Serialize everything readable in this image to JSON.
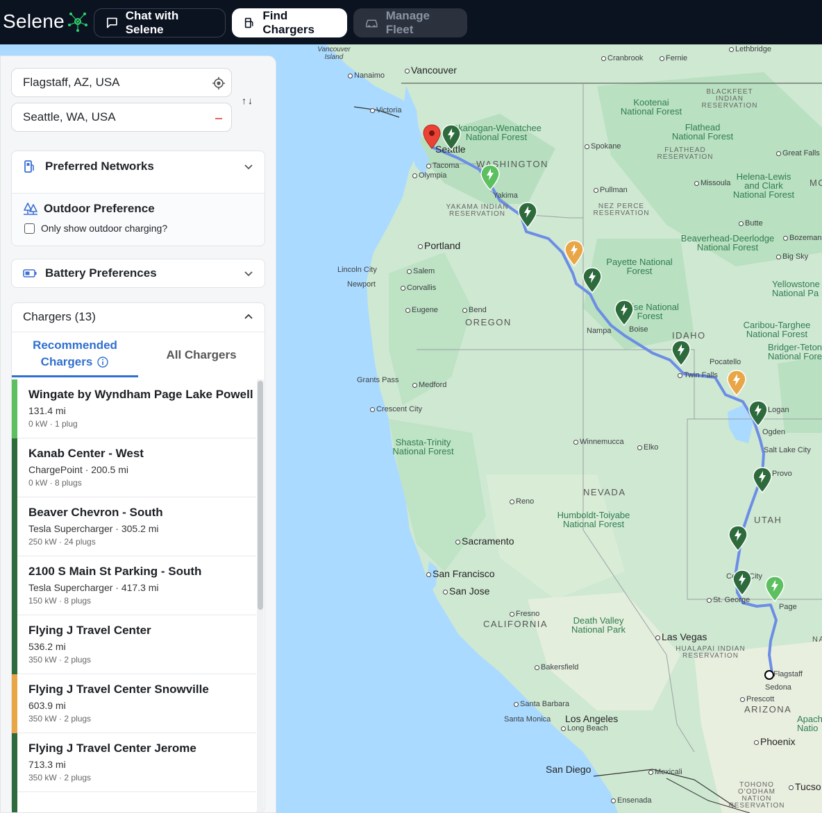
{
  "header": {
    "logo_text": "Selene",
    "nav": {
      "chat_label": "Chat with Selene",
      "find_label": "Find Chargers",
      "fleet_label": "Manage Fleet"
    }
  },
  "route": {
    "from_value": "Flagstaff, AZ, USA",
    "to_value": "Seattle, WA, USA",
    "swap_label": "↑↓"
  },
  "preferred_networks": {
    "title": "Preferred Networks"
  },
  "outdoor": {
    "title": "Outdoor Preference",
    "checkbox_label": "Only show outdoor charging?",
    "checked": false
  },
  "battery": {
    "title": "Battery Preferences"
  },
  "chargers": {
    "title": "Chargers (13)",
    "tabs": {
      "recommended_line1": "Recommended",
      "recommended_line2": "Chargers",
      "all": "All Chargers"
    },
    "items": [
      {
        "name": "Wingate by Wyndham Page Lake Powell",
        "sub": "131.4 mi",
        "meta": "0 kW · 1 plug",
        "color": "#5cbf60"
      },
      {
        "name": "Kanab Center - West",
        "sub": "ChargePoint · 200.5 mi",
        "meta": "0 kW · 8 plugs",
        "color": "#2e6b3c"
      },
      {
        "name": "Beaver Chevron - South",
        "sub": "Tesla Supercharger · 305.2 mi",
        "meta": "250 kW · 24 plugs",
        "color": "#2e6b3c"
      },
      {
        "name": "2100 S Main St Parking - South",
        "sub": "Tesla Supercharger · 417.3 mi",
        "meta": "150 kW · 8 plugs",
        "color": "#2e6b3c"
      },
      {
        "name": "Flying J Travel Center",
        "sub": "536.2 mi",
        "meta": "350 kW · 2 plugs",
        "color": "#2e6b3c"
      },
      {
        "name": "Flying J Travel Center Snowville",
        "sub": "603.9 mi",
        "meta": "350 kW · 2 plugs",
        "color": "#e9a646"
      },
      {
        "name": "Flying J Travel Center Jerome",
        "sub": "713.3 mi",
        "meta": "350 kW · 2 plugs",
        "color": "#2e6b3c"
      },
      {
        "name": "",
        "sub": "",
        "meta": "",
        "color": "#2e6b3c"
      }
    ]
  },
  "map": {
    "labels": {
      "vancouver_island": "Vancouver Island",
      "nanaimo": "Nanaimo",
      "vancouver": "Vancouver",
      "victoria": "Victoria",
      "seattle": "Seattle",
      "tacoma": "Tacoma",
      "olympia": "Olympia",
      "washington": "WASHINGTON",
      "okanogan": "Okanogan-Wenatchee National Forest",
      "yakima": "Yakima",
      "yakama": "YAKAMA INDIAN RESERVATION",
      "portland": "Portland",
      "lincoln_city": "Lincoln City",
      "salem": "Salem",
      "newport": "Newport",
      "corvallis": "Corvallis",
      "eugene": "Eugene",
      "bend": "Bend",
      "oregon": "OREGON",
      "grants_pass": "Grants Pass",
      "medford": "Medford",
      "crescent_city": "Crescent City",
      "shasta": "Shasta-Trinity National Forest",
      "cranbrook": "Cranbrook",
      "fernie": "Fernie",
      "lethbridge": "Lethbridge",
      "kootenai": "Kootenai National Forest",
      "blackfeet": "BLACKFEET INDIAN RESERVATION",
      "flathead_nf": "Flathead National Forest",
      "flathead_res": "FLATHEAD RESERVATION",
      "spokane": "Spokane",
      "great_falls": "Great Falls",
      "helena": "Helena-Lewis and Clark National Forest",
      "missoula": "Missoula",
      "mo": "MO",
      "pullman": "Pullman",
      "nez_perce": "NEZ PERCE RESERVATION",
      "butte": "Butte",
      "beaverhead": "Beaverhead-Deerlodge National Forest",
      "bozeman": "Bozeman",
      "big_sky": "Big Sky",
      "payette": "Payette National Forest",
      "yellowstone": "Yellowstone National Pa",
      "boise_nf": "Boise National Forest",
      "boise": "Boise",
      "nampa": "Nampa",
      "idaho": "IDAHO",
      "caribou": "Caribou-Targhee National Forest",
      "bridger": "Bridger-Teton National Fore",
      "pocatello": "Pocatello",
      "twin_falls": "Twin Falls",
      "logan": "Logan",
      "ogden": "Ogden",
      "salt_lake": "Salt Lake City",
      "provo": "Provo",
      "winnemucca": "Winnemucca",
      "elko": "Elko",
      "nevada": "NEVADA",
      "reno": "Reno",
      "humboldt": "Humboldt-Toiyabe National Forest",
      "utah": "UTAH",
      "sacramento": "Sacramento",
      "san_francisco": "San Francisco",
      "san_jose": "San Jose",
      "cedar_city": "Cedar City",
      "st_george": "St. George",
      "page": "Page",
      "fresno": "Fresno",
      "california": "CALIFORNIA",
      "death_valley": "Death Valley National Park",
      "las_vegas": "Las Vegas",
      "hualapai": "HUALAPAI INDIAN RESERVATION",
      "flagstaff": "Flagstaff",
      "sedona": "Sedona",
      "bakersfield": "Bakersfield",
      "prescott": "Prescott",
      "arizona": "ARIZONA",
      "santa_barbara": "Santa Barbara",
      "los_angeles": "Los Angeles",
      "santa_monica": "Santa Monica",
      "long_beach": "Long Beach",
      "apache": "Apach Natio",
      "phoenix": "Phoenix",
      "san_diego": "San Diego",
      "mexicali": "Mexicali",
      "ensenada": "Ensenada",
      "tohono": "TOHONO O'ODHAM NATION RESERVATION",
      "tucson": "Tucso",
      "na": "NA"
    }
  }
}
